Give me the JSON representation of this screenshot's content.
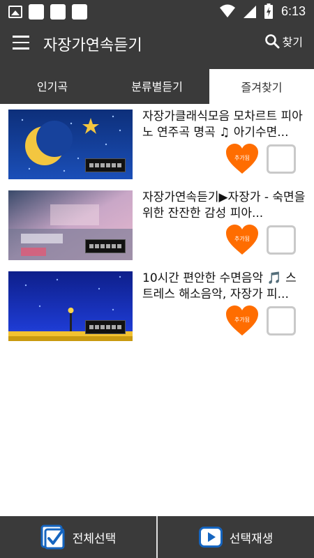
{
  "statusbar": {
    "time": "6:13"
  },
  "appbar": {
    "title": "자장가연속듣기",
    "search_label": "찾기"
  },
  "tabs": [
    {
      "label": "인기곡",
      "active": false
    },
    {
      "label": "분류별듣기",
      "active": false
    },
    {
      "label": "즐겨찾기",
      "active": true
    }
  ],
  "items": [
    {
      "title": "자장가클래식모음 모차르트 피아노 연주곡 명곡 ♫ 아기수면...",
      "favorite_label": "추가됨",
      "checked": false
    },
    {
      "title": "자장가연속듣기▶자장가 - 숙면을 위한 잔잔한 감성 피아...",
      "favorite_label": "추가됨",
      "checked": false
    },
    {
      "title": "10시간 편안한 수면음악 🎵 스트레스 해소음악, 자장가 피...",
      "favorite_label": "추가됨",
      "checked": false
    }
  ],
  "bottombar": {
    "select_all_label": "전체선택",
    "play_selected_label": "선택재생"
  },
  "colors": {
    "bar": "#3a3a3a",
    "heart": "#ff6d00",
    "checkbox_border": "#c9c9c9",
    "play_icon": "#1565c0"
  }
}
